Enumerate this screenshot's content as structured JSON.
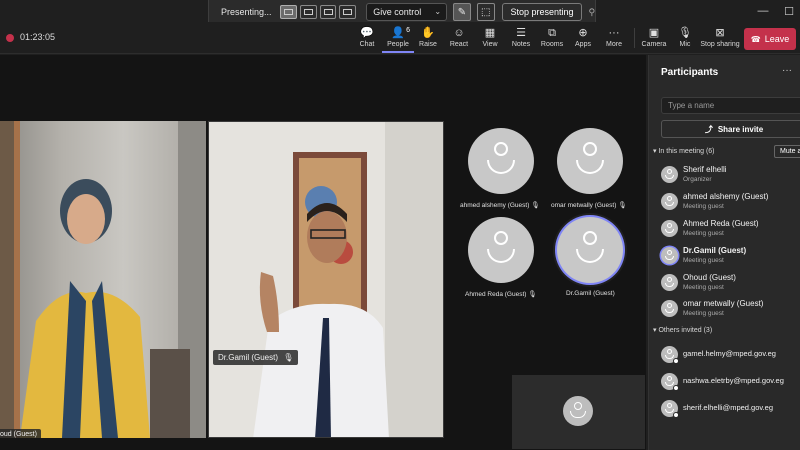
{
  "presenting_bar": {
    "status_label": "Presenting...",
    "give_control_label": "Give control",
    "stop_presenting_label": "Stop presenting"
  },
  "meeting": {
    "elapsed_time": "01:23:05",
    "recording_color": "#c4314b"
  },
  "toolbar": {
    "items": [
      {
        "label": "Chat",
        "icon": "chat-icon"
      },
      {
        "label": "People",
        "icon": "people-icon",
        "badge": "6"
      },
      {
        "label": "Raise",
        "icon": "raise-hand-icon"
      },
      {
        "label": "React",
        "icon": "react-icon"
      },
      {
        "label": "View",
        "icon": "view-icon"
      },
      {
        "label": "Notes",
        "icon": "notes-icon"
      },
      {
        "label": "Rooms",
        "icon": "rooms-icon"
      },
      {
        "label": "Apps",
        "icon": "apps-icon"
      },
      {
        "label": "More",
        "icon": "more-icon"
      },
      {
        "label": "Camera",
        "icon": "camera-off-icon"
      },
      {
        "label": "Mic",
        "icon": "mic-off-icon"
      },
      {
        "label": "Stop sharing",
        "icon": "stop-sharing-icon"
      }
    ],
    "leave_label": "Leave",
    "leave_color": "#c4314b",
    "accent_color": "#7f85f5"
  },
  "stage": {
    "video_tiles": [
      {
        "name": "oud (Guest)"
      },
      {
        "name": "Dr.Gamil (Guest)"
      }
    ],
    "avatar_tiles": [
      {
        "name": "ahmed alshemy (Guest)"
      },
      {
        "name": "omar metwally (Guest)"
      },
      {
        "name": "Ahmed Reda (Guest)"
      },
      {
        "name": "Dr.Gamil (Guest)"
      }
    ]
  },
  "participants_panel": {
    "title": "Participants",
    "search_placeholder": "Type a name",
    "share_invite_label": "Share invite",
    "in_meeting_header": "In this meeting (6)",
    "mute_all_label": "Mute a",
    "in_meeting": [
      {
        "name": "Sherif elhelli",
        "role": "Organizer"
      },
      {
        "name": "ahmed alshemy (Guest)",
        "role": "Meeting guest"
      },
      {
        "name": "Ahmed Reda (Guest)",
        "role": "Meeting guest"
      },
      {
        "name": "Dr.Gamil (Guest)",
        "role": "Meeting guest"
      },
      {
        "name": "Ohoud (Guest)",
        "role": "Meeting guest"
      },
      {
        "name": "omar metwally (Guest)",
        "role": "Meeting guest"
      }
    ],
    "others_header": "Others invited (3)",
    "others": [
      {
        "email": "gamel.helmy@mped.gov.eg"
      },
      {
        "email": "nashwa.eletrby@mped.gov.eg"
      },
      {
        "email": "sherif.elhelli@mped.gov.eg"
      }
    ]
  }
}
